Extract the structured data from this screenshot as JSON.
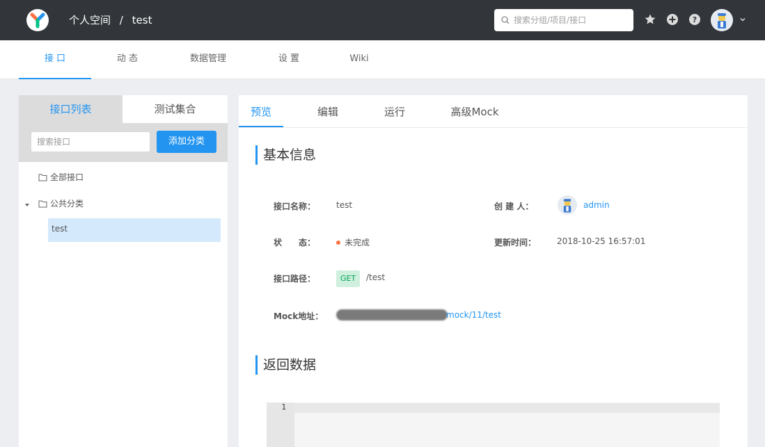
{
  "header": {
    "breadcrumb": [
      "个人空间",
      "/",
      "test"
    ],
    "search_placeholder": "搜索分组/项目/接口"
  },
  "subnav": {
    "items": [
      "接 口",
      "动 态",
      "数据管理",
      "设 置",
      "Wiki"
    ]
  },
  "left": {
    "tabs": [
      "接口列表",
      "测试集合"
    ],
    "search_placeholder": "搜索接口",
    "add_button": "添加分类",
    "tree": {
      "all": "全部接口",
      "category": "公共分类",
      "selected_item": "test"
    }
  },
  "right": {
    "tabs": [
      "预览",
      "编辑",
      "运行",
      "高级Mock"
    ],
    "section_basic": "基本信息",
    "section_return": "返回数据",
    "fields": {
      "name_label": "接口名称：",
      "name_value": "test",
      "creator_label": "创 建 人：",
      "creator_value": "admin",
      "status_label": "状　　态：",
      "status_value": "未完成",
      "updated_label": "更新时间：",
      "updated_value": "2018-10-25 16:57:01",
      "path_label": "接口路径：",
      "method": "GET",
      "path_value": "/test",
      "mock_label": "Mock地址：",
      "mock_value": "mock/11/test"
    },
    "editor": {
      "line_number": "1"
    }
  },
  "colors": {
    "accent": "#2395f1",
    "header_bg": "#32363a",
    "status_orange": "#fd7043",
    "get_green": "#00a854"
  }
}
